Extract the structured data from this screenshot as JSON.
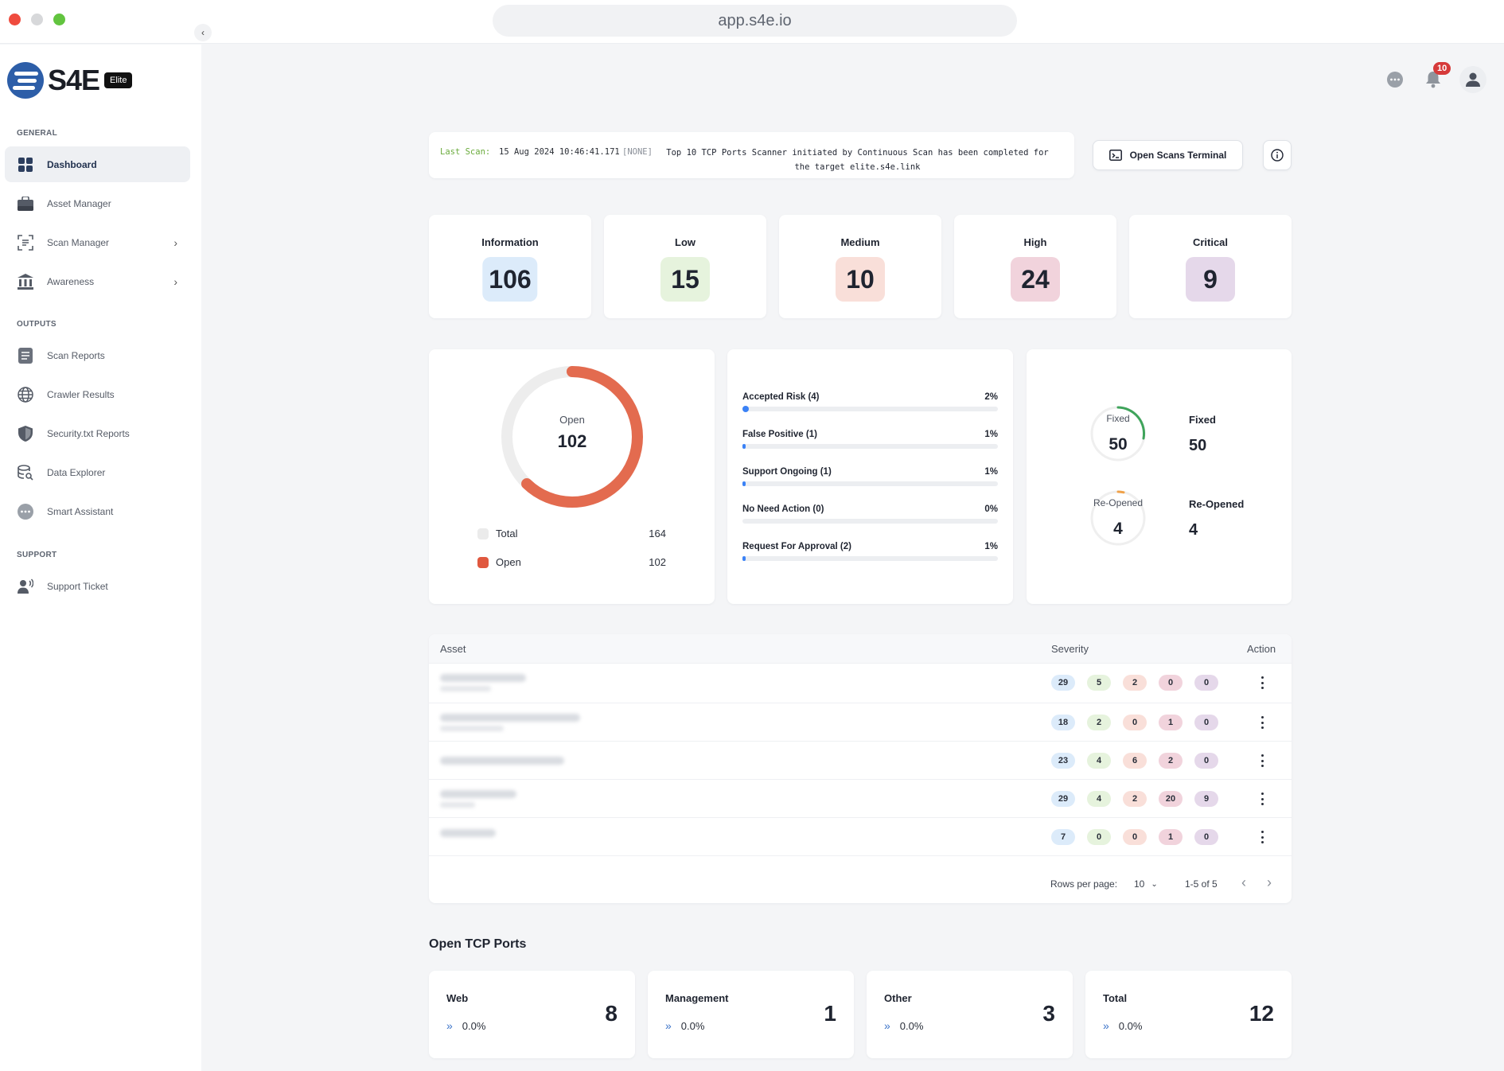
{
  "browser": {
    "url": "app.s4e.io"
  },
  "brand": {
    "name": "S4E",
    "badge": "Elite"
  },
  "sidebar": {
    "sections": [
      {
        "title": "GENERAL",
        "items": [
          {
            "label": "Dashboard",
            "icon": "dashboard-icon",
            "active": true
          },
          {
            "label": "Asset Manager",
            "icon": "briefcase-icon"
          },
          {
            "label": "Scan Manager",
            "icon": "scan-icon",
            "expandable": true
          },
          {
            "label": "Awareness",
            "icon": "bank-icon",
            "expandable": true
          }
        ]
      },
      {
        "title": "OUTPUTS",
        "items": [
          {
            "label": "Scan Reports",
            "icon": "report-icon"
          },
          {
            "label": "Crawler Results",
            "icon": "globe-icon"
          },
          {
            "label": "Security.txt Reports",
            "icon": "shield-icon"
          },
          {
            "label": "Data Explorer",
            "icon": "database-search-icon"
          },
          {
            "label": "Smart Assistant",
            "icon": "chat-icon"
          }
        ]
      },
      {
        "title": "SUPPORT",
        "items": [
          {
            "label": "Support Ticket",
            "icon": "support-agent-icon"
          }
        ]
      }
    ]
  },
  "header": {
    "notifications_count": "10"
  },
  "last_scan": {
    "label": "Last Scan:",
    "timestamp": "15 Aug 2024 10:46:41.171",
    "tag": "[NONE]",
    "message": "Top 10 TCP Ports Scanner initiated by Continuous Scan has been completed for the target elite.s4e.link"
  },
  "actions": {
    "open_terminal": "Open Scans Terminal"
  },
  "severity_cards": [
    {
      "label": "Information",
      "value": "106",
      "color": "#dcebfa"
    },
    {
      "label": "Low",
      "value": "15",
      "color": "#e6f3dd"
    },
    {
      "label": "Medium",
      "value": "10",
      "color": "#f9dfd9"
    },
    {
      "label": "High",
      "value": "24",
      "color": "#f1d3dc"
    },
    {
      "label": "Critical",
      "value": "9",
      "color": "#e5d8ea"
    }
  ],
  "open_donut": {
    "center_label": "Open",
    "center_value": "102",
    "total": 164,
    "open": 102,
    "legend": [
      {
        "label": "Total",
        "value": "164",
        "color": "#ebebeb"
      },
      {
        "label": "Open",
        "value": "102",
        "color": "#e0583f"
      }
    ]
  },
  "statuses": [
    {
      "label": "Accepted Risk (4)",
      "percent": "2%",
      "fraction": 0.02
    },
    {
      "label": "False Positive (1)",
      "percent": "1%",
      "fraction": 0.01
    },
    {
      "label": "Support Ongoing (1)",
      "percent": "1%",
      "fraction": 0.01
    },
    {
      "label": "No Need Action (0)",
      "percent": "0%",
      "fraction": 0
    },
    {
      "label": "Request For Approval (2)",
      "percent": "1%",
      "fraction": 0.01
    }
  ],
  "fix_stats": {
    "fixed": {
      "label": "Fixed",
      "value": "50",
      "color": "#3fa45b"
    },
    "reopened": {
      "label": "Re-Opened",
      "value": "4",
      "color": "#f0a24a"
    }
  },
  "asset_table": {
    "columns": {
      "asset": "Asset",
      "severity": "Severity",
      "action": "Action"
    },
    "rows": [
      {
        "severity": [
          "29",
          "5",
          "2",
          "0",
          "0"
        ]
      },
      {
        "severity": [
          "18",
          "2",
          "0",
          "1",
          "0"
        ]
      },
      {
        "severity": [
          "23",
          "4",
          "6",
          "2",
          "0"
        ]
      },
      {
        "severity": [
          "29",
          "4",
          "2",
          "20",
          "9"
        ]
      },
      {
        "severity": [
          "7",
          "0",
          "0",
          "1",
          "0"
        ]
      }
    ],
    "pill_colors": [
      "#dcebfa",
      "#e6f3dd",
      "#f9dfd9",
      "#f1d3dc",
      "#e5d8ea"
    ],
    "rows_per_page_label": "Rows per page:",
    "rows_per_page": "10",
    "range": "1-5 of 5"
  },
  "open_tcp_ports": {
    "title": "Open TCP Ports",
    "cards": [
      {
        "label": "Web",
        "percent": "0.0%",
        "value": "8"
      },
      {
        "label": "Management",
        "percent": "0.0%",
        "value": "1"
      },
      {
        "label": "Other",
        "percent": "0.0%",
        "value": "3"
      },
      {
        "label": "Total",
        "percent": "0.0%",
        "value": "12"
      }
    ]
  }
}
